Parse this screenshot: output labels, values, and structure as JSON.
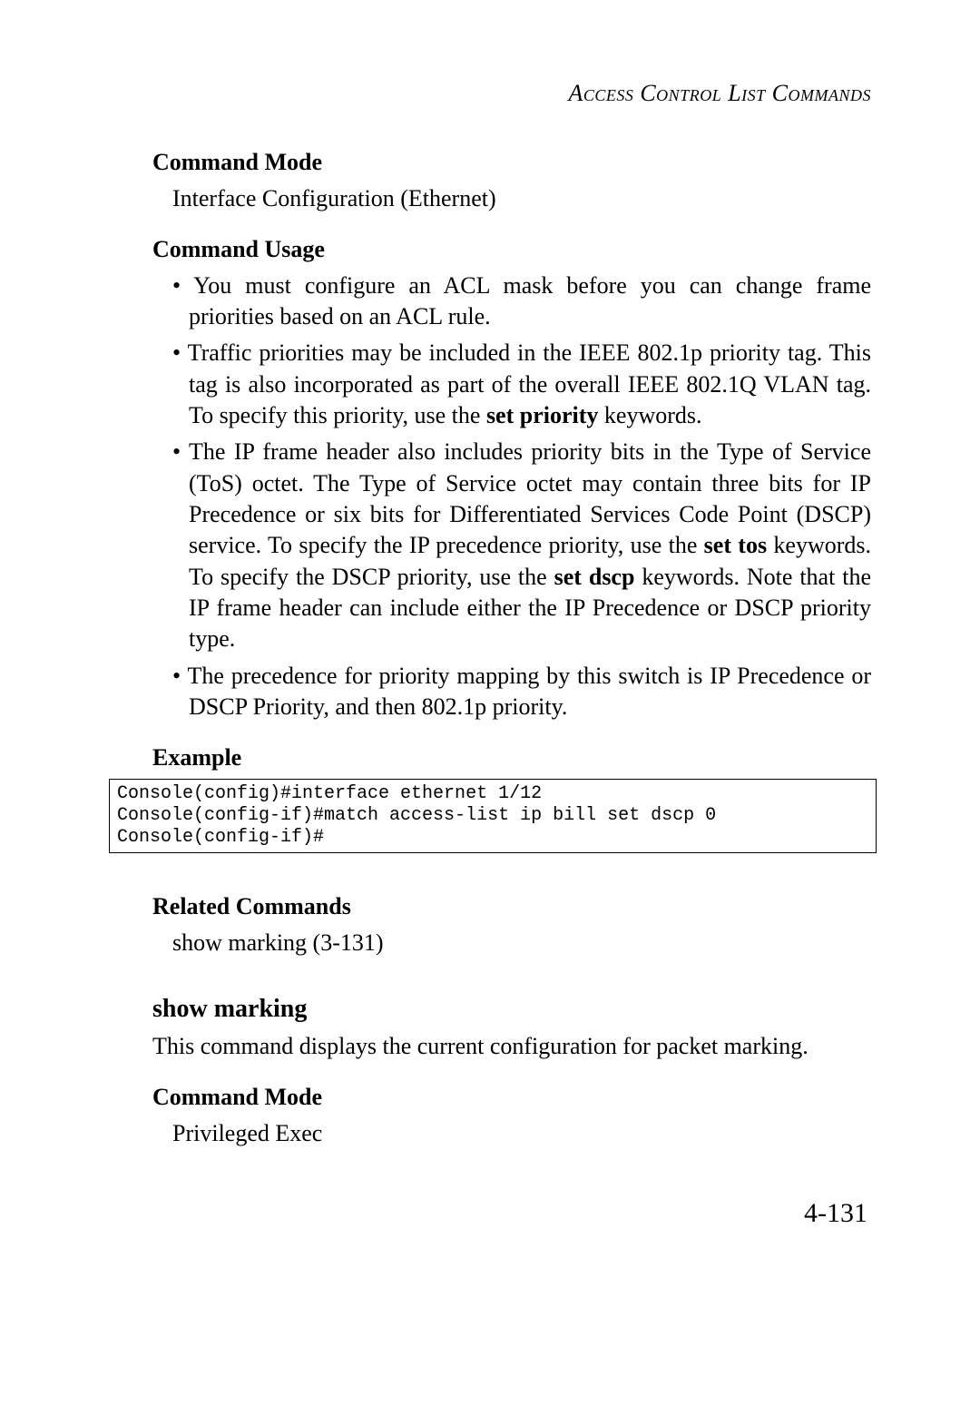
{
  "header": {
    "running_title": "Access Control List Commands"
  },
  "sections": {
    "cmd_mode_1": {
      "heading": "Command Mode",
      "text": "Interface Configuration (Ethernet)"
    },
    "cmd_usage": {
      "heading": "Command Usage",
      "bullets": {
        "b1": "You must configure an ACL mask before you can change frame priorities based on an ACL rule.",
        "b2_pre": "Traffic priorities may be included in the IEEE 802.1p priority tag. This tag is also incorporated as part of the overall IEEE 802.1Q VLAN tag. To specify this priority, use the ",
        "b2_bold": "set priority",
        "b2_post": " keywords.",
        "b3_pre": "The IP frame header also includes priority bits in the Type of Service (ToS) octet. The Type of Service octet may contain three bits for IP Precedence or six bits for Differentiated Services Code Point (DSCP) service. To specify the IP precedence priority, use the ",
        "b3_bold1": "set tos",
        "b3_mid": " keywords. To specify the DSCP priority, use the ",
        "b3_bold2": "set dscp",
        "b3_post": " keywords. Note that the IP frame header can include either the IP Precedence or DSCP priority type.",
        "b4": "The precedence for priority mapping by this switch is IP Precedence or DSCP Priority, and then 802.1p priority."
      }
    },
    "example": {
      "heading": "Example",
      "code": "Console(config)#interface ethernet 1/12\nConsole(config-if)#match access-list ip bill set dscp 0\nConsole(config-if)#"
    },
    "related": {
      "heading": "Related Commands",
      "text": "show marking (3-131)"
    },
    "show_marking": {
      "heading": "show marking",
      "description": "This command displays the current configuration for packet marking."
    },
    "cmd_mode_2": {
      "heading": "Command Mode",
      "text": "Privileged Exec"
    }
  },
  "footer": {
    "page_number": "4-131"
  }
}
